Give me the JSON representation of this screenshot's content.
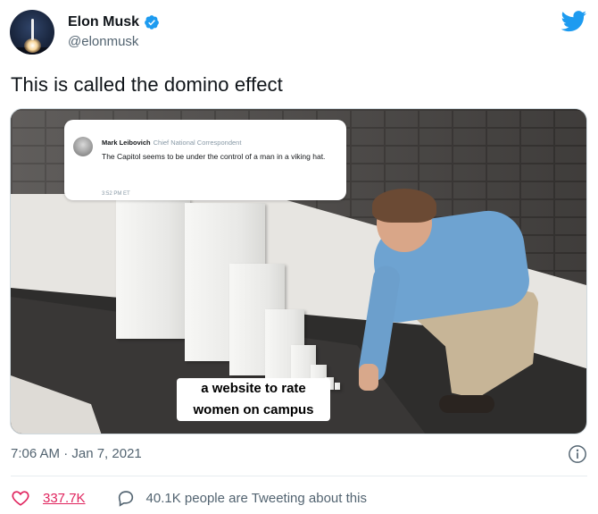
{
  "author": {
    "display_name": "Elon Musk",
    "handle": "@elonmusk",
    "verified": true
  },
  "tweet": {
    "text": "This is called the domino effect",
    "timestamp": "7:06 AM · Jan 7, 2021"
  },
  "media": {
    "quote": {
      "name": "Mark Leibovich",
      "title": "Chief National Correspondent",
      "body": "The Capitol seems to be under the control of a man in a viking hat.",
      "time": "3:52 PM ET"
    },
    "caption": "a website to rate women on campus"
  },
  "stats": {
    "likes": "337.7K",
    "talking": "40.1K people are Tweeting about this"
  },
  "icons": {
    "verified": "verified-badge-icon",
    "brand": "twitter-bird-icon",
    "info": "info-icon",
    "like": "heart-icon",
    "reply": "speech-bubble-icon"
  },
  "colors": {
    "brand_blue": "#1d9bf0",
    "like_red": "#e0245e",
    "secondary_text": "#536471"
  }
}
